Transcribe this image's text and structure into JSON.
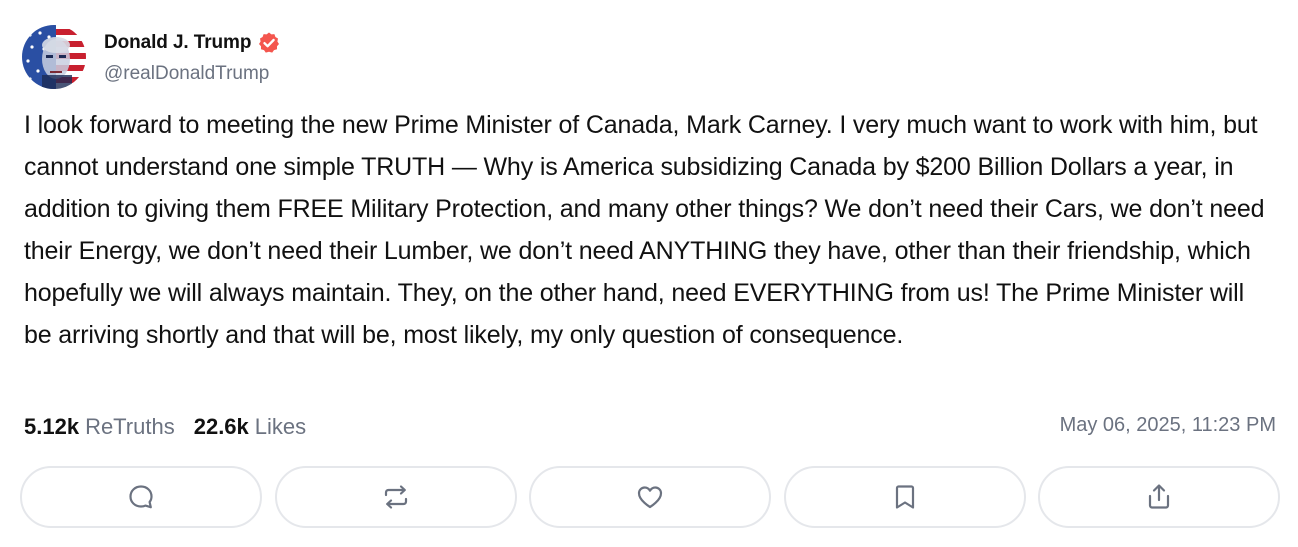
{
  "post": {
    "author": {
      "display_name": "Donald J. Trump",
      "handle": "@realDonaldTrump",
      "verified": true,
      "verified_color": "#f4564e"
    },
    "text": "I look forward to meeting the new Prime Minister of Canada, Mark Carney. I very much want to work with him, but cannot understand one simple TRUTH — Why is America subsidizing Canada by $200 Billion Dollars a year, in addition to giving them FREE Military Protection, and many other things? We don’t need their Cars, we don’t need their Energy, we don’t need their Lumber, we don’t need ANYTHING they have, other than their friendship, which hopefully we will always maintain. They, on the other hand, need EVERYTHING from us! The Prime Minister will be arriving shortly and that will be, most likely, my only question of consequence.",
    "stats": {
      "retruths_count": "5.12k",
      "retruths_label": "ReTruths",
      "likes_count": "22.6k",
      "likes_label": "Likes"
    },
    "timestamp": "May 06, 2025, 11:23 PM"
  },
  "actions": [
    {
      "name": "reply",
      "icon": "comment-icon"
    },
    {
      "name": "retruth",
      "icon": "repost-icon"
    },
    {
      "name": "like",
      "icon": "heart-icon"
    },
    {
      "name": "bookmark",
      "icon": "bookmark-icon"
    },
    {
      "name": "share",
      "icon": "share-icon"
    }
  ],
  "colors": {
    "text": "#111111",
    "muted": "#6b7280",
    "border": "#e5e7eb",
    "icon": "#6b7280"
  }
}
